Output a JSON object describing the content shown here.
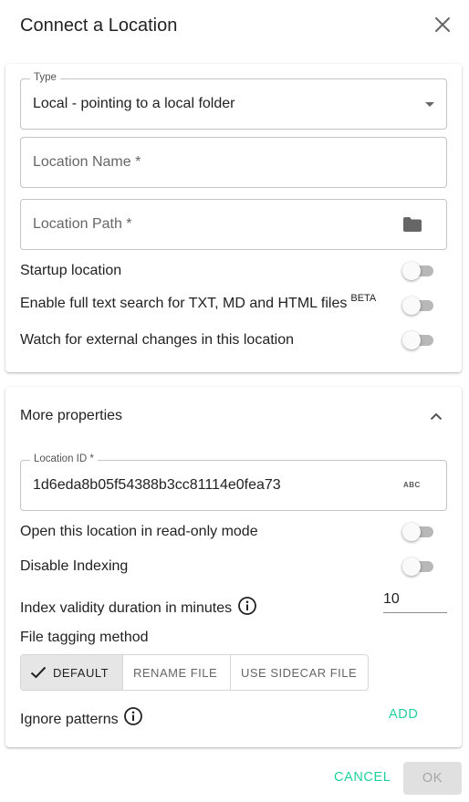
{
  "dialog": {
    "title": "Connect a Location",
    "close_icon": "close-icon"
  },
  "location_card": {
    "type_field": {
      "label": "Type",
      "value": "Local - pointing to a local folder",
      "icon": "dropdown-arrow-icon"
    },
    "name_field": {
      "placeholder": "Location Name *"
    },
    "path_field": {
      "placeholder": "Location Path *",
      "icon": "folder-icon"
    },
    "toggles": [
      {
        "label": "Startup location",
        "checked": false
      },
      {
        "label": "Enable full text search for TXT, MD and HTML files",
        "badge": "BETA",
        "checked": false
      },
      {
        "label": "Watch for external changes in this location",
        "checked": false
      }
    ]
  },
  "more_card": {
    "header": "More properties",
    "expand_icon": "chevron-up-icon",
    "location_id": {
      "label": "Location ID *",
      "value": "1d6eda8b05f54388b3cc81114e0fea73",
      "icon_text": "ABC"
    },
    "toggles": [
      {
        "label": "Open this location in read-only mode",
        "checked": false
      },
      {
        "label": "Disable Indexing",
        "checked": false
      }
    ],
    "index_validity": {
      "label": "Index validity duration in minutes",
      "value": "10",
      "icon": "info-icon"
    },
    "tagging": {
      "label": "File tagging method",
      "options": [
        "DEFAULT",
        "RENAME FILE",
        "USE SIDECAR FILE"
      ],
      "selected": "DEFAULT",
      "check_icon": "check-icon"
    },
    "ignore_patterns": {
      "label": "Ignore patterns",
      "icon": "info-icon",
      "add_label": "ADD"
    }
  },
  "footer": {
    "cancel_label": "CANCEL",
    "ok_label": "OK"
  },
  "colors": {
    "accent": "#1dd19f",
    "toggle_track": "#b8b8b8",
    "disabled_button": "#e0e0e0"
  }
}
